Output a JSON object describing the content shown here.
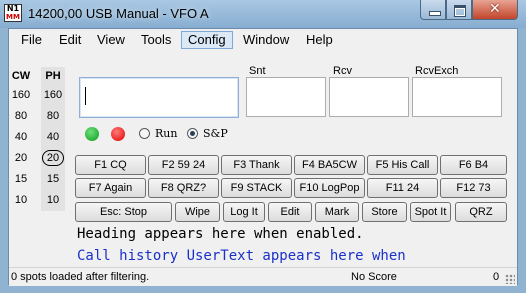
{
  "window": {
    "title": "14200,00 USB Manual - VFO A",
    "app_icon_top": "N1",
    "app_icon_bottom": "MM"
  },
  "menu": [
    "File",
    "Edit",
    "View",
    "Tools",
    "Config",
    "Window",
    "Help"
  ],
  "active_menu": "Config",
  "bands": {
    "cw_header": "CW",
    "ph_header": "PH",
    "cw": [
      "160",
      "80",
      "40",
      "20",
      "15",
      "10"
    ],
    "ph": [
      "160",
      "80",
      "40",
      "20",
      "15",
      "10"
    ],
    "selected_ph": "20"
  },
  "entry": {
    "call_value": "",
    "snt_label": "Snt",
    "rcv_label": "Rcv",
    "rcvexch_label": "RcvExch",
    "snt_value": "",
    "rcv_value": "",
    "rcvexch_value": ""
  },
  "mode": {
    "run_label": "Run",
    "sp_label": "S&P",
    "selected": "S&P",
    "green_icon": "green-light-icon",
    "red_icon": "red-light-icon"
  },
  "function_keys": {
    "row1": [
      "F1 CQ",
      "F2 59 24",
      "F3 Thank",
      "F4 BA5CW",
      "F5 His Call",
      "F6 B4"
    ],
    "row2": [
      "F7 Again",
      "F8 QRZ?",
      "F9 STACK",
      "F10 LogPop",
      "F11 24",
      "F12 73"
    ],
    "row3": [
      "Esc: Stop",
      "Wipe",
      "Log It",
      "Edit",
      "Mark",
      "Store",
      "Spot It",
      "QRZ"
    ]
  },
  "info": {
    "heading": "Heading appears here when enabled.",
    "usertext": "Call history UserText appears here when"
  },
  "status": {
    "spots": "0 spots loaded after filtering.",
    "score": "No Score",
    "count": "0"
  },
  "colors": {
    "titlebar": "#8fb3d1",
    "usertext": "#1a30c8",
    "active_menu": "#dbe8f6"
  }
}
